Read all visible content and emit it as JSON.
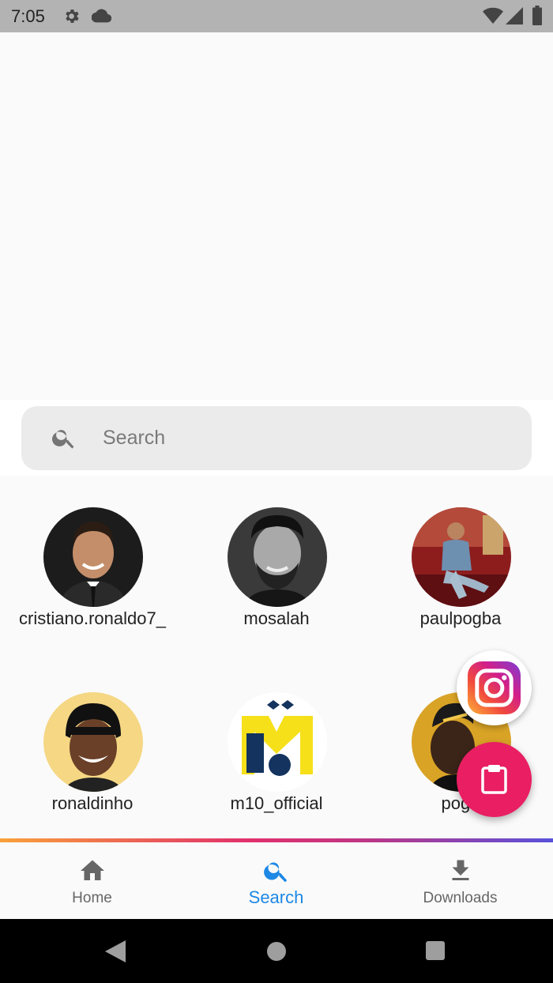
{
  "status_bar": {
    "time": "7:05"
  },
  "search": {
    "placeholder": "Search",
    "value": ""
  },
  "accounts": [
    {
      "username": "cristiano.ronaldo7_"
    },
    {
      "username": "mosalah"
    },
    {
      "username": "paulpogba"
    },
    {
      "username": "ronaldinho"
    },
    {
      "username": "m10_official"
    },
    {
      "username": "pogu"
    }
  ],
  "fabs": {
    "instagram_icon": "instagram-icon",
    "clipboard_icon": "clipboard-icon",
    "clipboard_color": "#e91e63"
  },
  "bottom_nav": {
    "active": "Search",
    "items": [
      {
        "label": "Home",
        "icon": "home-icon"
      },
      {
        "label": "Search",
        "icon": "search-icon"
      },
      {
        "label": "Downloads",
        "icon": "download-icon"
      }
    ],
    "active_color": "#1e88e5"
  },
  "android_nav": {
    "buttons": [
      "back",
      "home",
      "recents"
    ]
  }
}
